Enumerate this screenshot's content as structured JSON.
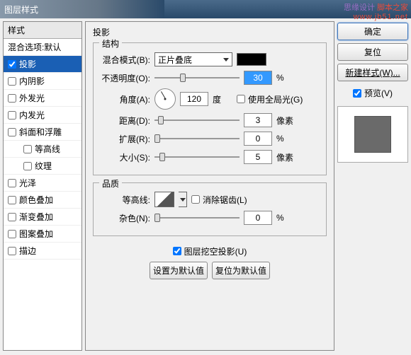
{
  "title": "图层样式",
  "watermark": {
    "line1a": "思缘设计",
    "line1b": "脚本之家",
    "line2": "www.jb51.net"
  },
  "styles": {
    "header": "样式",
    "subheader": "混合选项:默认",
    "items": [
      {
        "label": "投影",
        "checked": true,
        "selected": true
      },
      {
        "label": "内阴影",
        "checked": false
      },
      {
        "label": "外发光",
        "checked": false
      },
      {
        "label": "内发光",
        "checked": false
      },
      {
        "label": "斜面和浮雕",
        "checked": false
      },
      {
        "label": "等高线",
        "checked": false,
        "indent": true
      },
      {
        "label": "纹理",
        "checked": false,
        "indent": true
      },
      {
        "label": "光泽",
        "checked": false
      },
      {
        "label": "颜色叠加",
        "checked": false
      },
      {
        "label": "渐变叠加",
        "checked": false
      },
      {
        "label": "图案叠加",
        "checked": false
      },
      {
        "label": "描边",
        "checked": false
      }
    ]
  },
  "center": {
    "title": "投影",
    "structure": {
      "legend": "结构",
      "blendMode": {
        "label": "混合模式(B):",
        "value": "正片叠底"
      },
      "opacity": {
        "label": "不透明度(O):",
        "value": "30",
        "unit": "%",
        "thumb": 30
      },
      "angle": {
        "label": "角度(A):",
        "value": "120",
        "unit": "度"
      },
      "globalLight": {
        "label": "使用全局光(G)",
        "checked": false
      },
      "distance": {
        "label": "距离(D):",
        "value": "3",
        "unit": "像素",
        "thumb": 4
      },
      "spread": {
        "label": "扩展(R):",
        "value": "0",
        "unit": "%",
        "thumb": 0
      },
      "size": {
        "label": "大小(S):",
        "value": "5",
        "unit": "像素",
        "thumb": 6
      }
    },
    "quality": {
      "legend": "品质",
      "contour": {
        "label": "等高线:"
      },
      "antialias": {
        "label": "消除锯齿(L)",
        "checked": false
      },
      "noise": {
        "label": "杂色(N):",
        "value": "0",
        "unit": "%",
        "thumb": 0
      }
    },
    "knockout": {
      "label": "图层挖空投影(U)",
      "checked": true
    },
    "setDefault": "设置为默认值",
    "resetDefault": "复位为默认值"
  },
  "right": {
    "ok": "确定",
    "cancel": "复位",
    "newStyle": "新建样式(W)...",
    "preview": {
      "label": "预览(V)",
      "checked": true
    }
  }
}
